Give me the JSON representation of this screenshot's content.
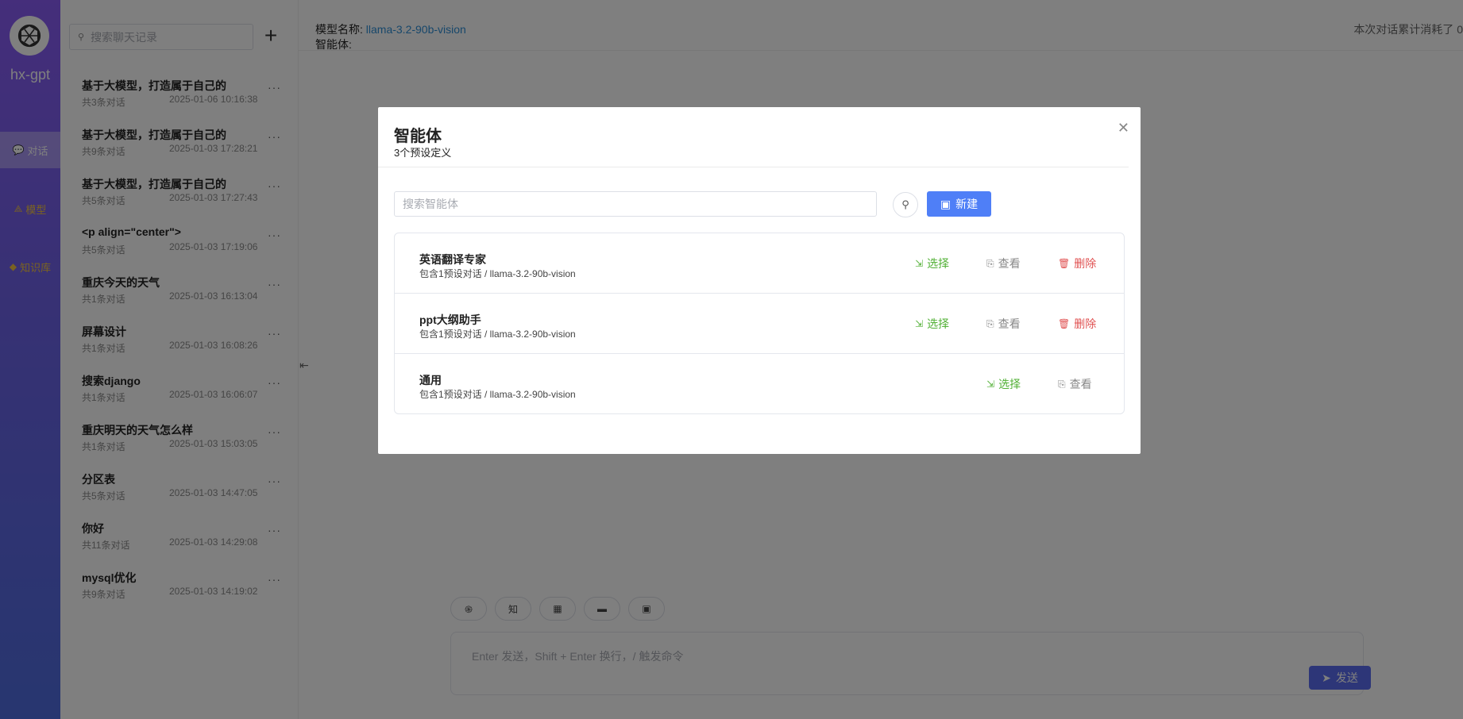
{
  "rail": {
    "brand": "hx-gpt",
    "nav": [
      {
        "label": "对话",
        "icon": "chat-icon"
      },
      {
        "label": "模型",
        "icon": "model-icon"
      },
      {
        "label": "知识库",
        "icon": "knowledge-icon"
      }
    ]
  },
  "sidebar": {
    "search_placeholder": "搜索聊天记录",
    "add_label": "+",
    "chats": [
      {
        "title": "基于大模型，打造属于自己的",
        "count": "共3条对话",
        "time": "2025-01-06 10:16:38"
      },
      {
        "title": "基于大模型，打造属于自己的",
        "count": "共9条对话",
        "time": "2025-01-03 17:28:21"
      },
      {
        "title": "基于大模型，打造属于自己的",
        "count": "共5条对话",
        "time": "2025-01-03 17:27:43"
      },
      {
        "title": "<p align=\"center\">",
        "count": "共5条对话",
        "time": "2025-01-03 17:19:06"
      },
      {
        "title": "重庆今天的天气",
        "count": "共1条对话",
        "time": "2025-01-03 16:13:04"
      },
      {
        "title": "屏幕设计",
        "count": "共1条对话",
        "time": "2025-01-03 16:08:26"
      },
      {
        "title": "搜索django",
        "count": "共1条对话",
        "time": "2025-01-03 16:06:07"
      },
      {
        "title": "重庆明天的天气怎么样",
        "count": "共1条对话",
        "time": "2025-01-03 15:03:05"
      },
      {
        "title": "分区表",
        "count": "共5条对话",
        "time": "2025-01-03 14:47:05"
      },
      {
        "title": "你好",
        "count": "共11条对话",
        "time": "2025-01-03 14:29:08"
      },
      {
        "title": "mysql优化",
        "count": "共9条对话",
        "time": "2025-01-03 14:19:02"
      }
    ],
    "more_label": "···"
  },
  "main": {
    "model_label": "模型名称:",
    "model_value": "llama-3.2-90b-vision",
    "agent_label": "智能体:",
    "usage_text": "本次对话累计消耗了 0",
    "tools": [
      {
        "icon": "openai-icon",
        "text": "֍"
      },
      {
        "icon": "knowledge-icon",
        "text": "知"
      },
      {
        "icon": "apps-icon",
        "text": "▦"
      },
      {
        "icon": "chat-bubble-icon",
        "text": "▬"
      },
      {
        "icon": "screen-icon",
        "text": "▣"
      }
    ],
    "input_placeholder": "Enter 发送，Shift + Enter 换行，/ 触发命令",
    "send_label": "发送"
  },
  "modal": {
    "title": "智能体",
    "subtitle": "3个预设定义",
    "search_placeholder": "搜索智能体",
    "new_label": "新建",
    "select_label": "选择",
    "view_label": "查看",
    "delete_label": "删除",
    "agents": [
      {
        "name": "英语翻译专家",
        "desc": "包含1预设对话 / llama-3.2-90b-vision",
        "deletable": true
      },
      {
        "name": "ppt大纲助手",
        "desc": "包含1预设对话 / llama-3.2-90b-vision",
        "deletable": true
      },
      {
        "name": "通用",
        "desc": "包含1预设对话 / llama-3.2-90b-vision",
        "deletable": false
      }
    ]
  }
}
